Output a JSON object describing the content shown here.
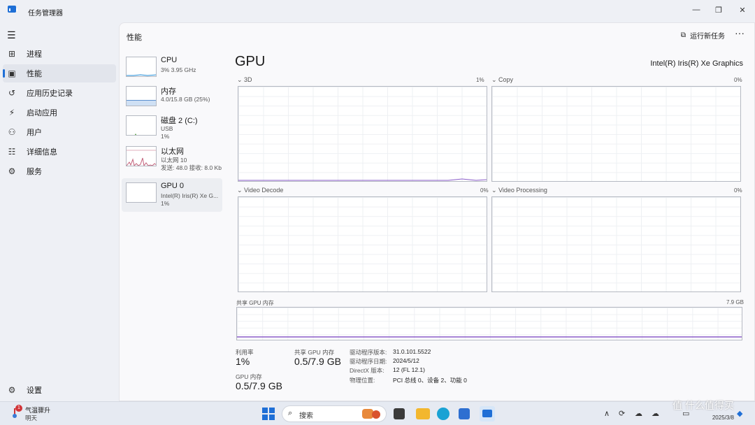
{
  "window": {
    "title": "任务管理器",
    "minimize": "—",
    "maximize": "❐",
    "close": "✕"
  },
  "nav": {
    "menu_icon": "hamburger-icon",
    "items": [
      {
        "label": "进程",
        "icon": "processes-icon"
      },
      {
        "label": "性能",
        "icon": "performance-icon"
      },
      {
        "label": "应用历史记录",
        "icon": "history-icon"
      },
      {
        "label": "启动应用",
        "icon": "startup-icon"
      },
      {
        "label": "用户",
        "icon": "users-icon"
      },
      {
        "label": "详细信息",
        "icon": "details-icon"
      },
      {
        "label": "服务",
        "icon": "services-icon"
      }
    ],
    "settings_label": "设置"
  },
  "header": {
    "title": "性能",
    "run_task": "运行新任务",
    "more": "···"
  },
  "resources": [
    {
      "name": "CPU",
      "line1": "3% 3.95 GHz",
      "line2": ""
    },
    {
      "name": "内存",
      "line1": "4.0/15.8 GB (25%)",
      "line2": ""
    },
    {
      "name": "磁盘 2 (C:)",
      "line1": "USB",
      "line2": "1%"
    },
    {
      "name": "以太网",
      "line1": "以太网 10",
      "line2": "发送: 48.0 接收: 8.0 Kb"
    },
    {
      "name": "GPU 0",
      "line1": "Intel(R) Iris(R) Xe G...",
      "line2": "1%"
    }
  ],
  "gpu": {
    "title": "GPU",
    "model": "Intel(R) Iris(R) Xe Graphics",
    "engines": [
      {
        "label": "3D",
        "pct": "1%"
      },
      {
        "label": "Copy",
        "pct": "0%"
      },
      {
        "label": "Video Decode",
        "pct": "0%"
      },
      {
        "label": "Video Processing",
        "pct": "0%"
      }
    ],
    "shared_label": "共享 GPU 内存",
    "shared_max": "7.9 GB",
    "stats": {
      "util_label": "利用率",
      "util_value": "1%",
      "shared_label": "共享 GPU 内存",
      "shared_value": "0.5/7.9 GB",
      "gpu_mem_label": "GPU 内存",
      "gpu_mem_value": "0.5/7.9 GB"
    },
    "info": [
      {
        "label": "驱动程序版本:",
        "value": "31.0.101.5522"
      },
      {
        "label": "驱动程序日期:",
        "value": "2024/5/12"
      },
      {
        "label": "DirectX 版本:",
        "value": "12 (FL 12.1)"
      },
      {
        "label": "物理位置:",
        "value": "PCI 总线 0、设备 2、功能 0"
      }
    ]
  },
  "taskbar": {
    "weather_line1": "气温骤升",
    "weather_line2": "明天",
    "weather_badge": "1",
    "search_placeholder": "搜索",
    "date": "2025/3/8",
    "watermark": "值 什么值得买"
  }
}
